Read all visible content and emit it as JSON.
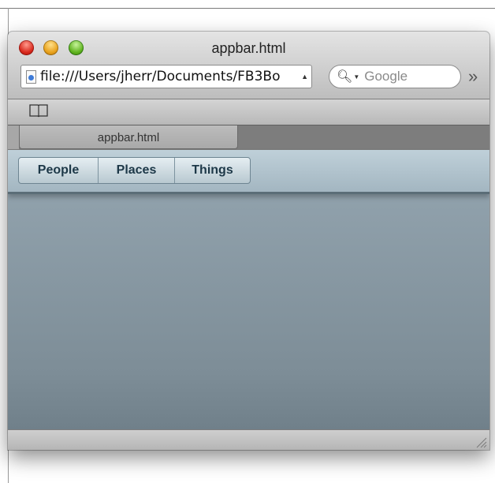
{
  "window": {
    "title": "appbar.html"
  },
  "toolbar": {
    "url": "file:///Users/jherr/Documents/FB3Bo",
    "search_placeholder": "Google",
    "overflow_symbol": "»"
  },
  "tab": {
    "label": "appbar.html"
  },
  "appbar": {
    "buttons": [
      {
        "label": "People"
      },
      {
        "label": "Places"
      },
      {
        "label": "Things"
      }
    ]
  },
  "colors": {
    "appbar_background": "#a8bac5",
    "content_background": "#8a9ba6",
    "button_text": "#1d3848"
  },
  "icons": {
    "page": "document-icon",
    "search": "search-icon",
    "bookmarks": "book-icon",
    "resize": "resize-grip-icon"
  }
}
